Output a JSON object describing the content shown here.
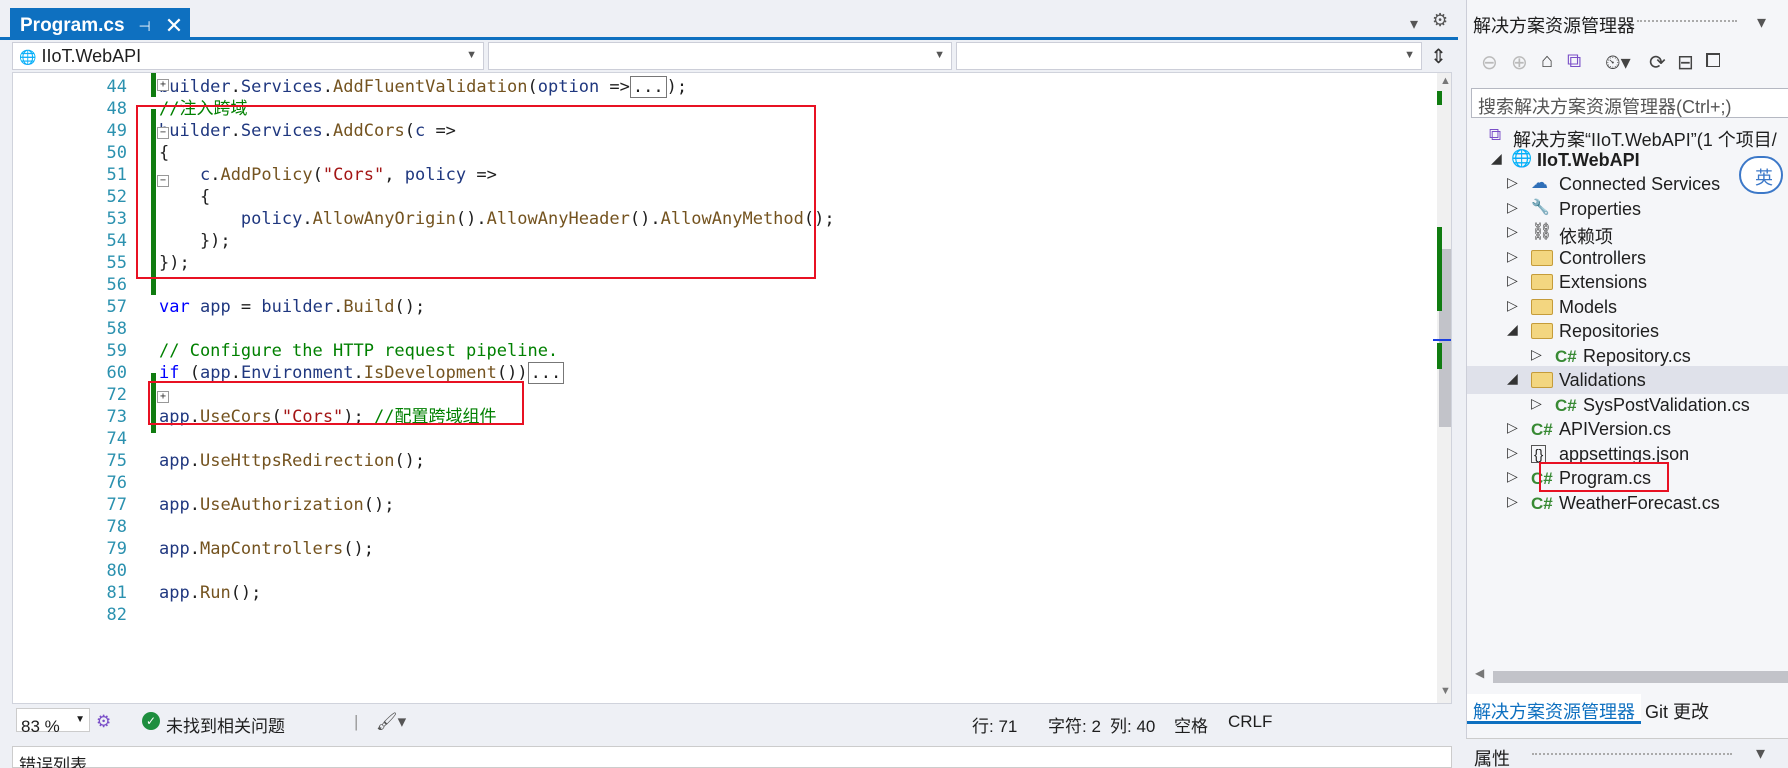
{
  "tab": {
    "title": "Program.cs",
    "pin": "⊣",
    "close": "✕"
  },
  "nav": {
    "project": "IIoT.WebAPI",
    "member": "",
    "symbol": ""
  },
  "code": {
    "lines": [
      {
        "n": "44",
        "parts": [
          [
            "prop",
            "builder"
          ],
          [
            "",
            "."
          ],
          [
            "prop",
            "Services"
          ],
          [
            "",
            "."
          ],
          [
            "mth",
            "AddFluentValidation"
          ],
          [
            "",
            "("
          ],
          [
            "prop",
            "option"
          ],
          [
            "",
            " =>"
          ]
        ],
        "suffix": "...",
        "tail": ");"
      },
      {
        "n": "48",
        "parts": [
          [
            "cm",
            "//注入跨域"
          ]
        ]
      },
      {
        "n": "49",
        "parts": [
          [
            "prop",
            "builder"
          ],
          [
            "",
            "."
          ],
          [
            "prop",
            "Services"
          ],
          [
            "",
            "."
          ],
          [
            "mth",
            "AddCors"
          ],
          [
            "",
            "("
          ],
          [
            "prop",
            "c"
          ],
          [
            "",
            " =>"
          ]
        ]
      },
      {
        "n": "50",
        "parts": [
          [
            "",
            "{"
          ]
        ]
      },
      {
        "n": "51",
        "parts": [
          [
            "",
            "    "
          ],
          [
            "prop",
            "c"
          ],
          [
            "",
            "."
          ],
          [
            "mth",
            "AddPolicy"
          ],
          [
            "",
            "("
          ],
          [
            "str",
            "\"Cors\""
          ],
          [
            "",
            ", "
          ],
          [
            "prop",
            "policy"
          ],
          [
            "",
            " =>"
          ]
        ]
      },
      {
        "n": "52",
        "parts": [
          [
            "",
            "    {"
          ]
        ]
      },
      {
        "n": "53",
        "parts": [
          [
            "",
            "        "
          ],
          [
            "prop",
            "policy"
          ],
          [
            "",
            "."
          ],
          [
            "mth",
            "AllowAnyOrigin"
          ],
          [
            "",
            "()."
          ],
          [
            "mth",
            "AllowAnyHeader"
          ],
          [
            "",
            "()."
          ],
          [
            "mth",
            "AllowAnyMethod"
          ],
          [
            "",
            "();"
          ]
        ]
      },
      {
        "n": "54",
        "parts": [
          [
            "",
            "    });"
          ]
        ]
      },
      {
        "n": "55",
        "parts": [
          [
            "",
            "});"
          ]
        ]
      },
      {
        "n": "56",
        "parts": []
      },
      {
        "n": "57",
        "parts": [
          [
            "kw",
            "var"
          ],
          [
            "",
            " "
          ],
          [
            "prop",
            "app"
          ],
          [
            "",
            " = "
          ],
          [
            "prop",
            "builder"
          ],
          [
            "",
            "."
          ],
          [
            "mth",
            "Build"
          ],
          [
            "",
            "();"
          ]
        ]
      },
      {
        "n": "58",
        "parts": []
      },
      {
        "n": "59",
        "parts": [
          [
            "cm",
            "// Configure the HTTP request pipeline."
          ]
        ]
      },
      {
        "n": "60",
        "parts": [
          [
            "kw",
            "if"
          ],
          [
            "",
            " ("
          ],
          [
            "prop",
            "app"
          ],
          [
            "",
            "."
          ],
          [
            "prop",
            "Environment"
          ],
          [
            "",
            "."
          ],
          [
            "mth",
            "IsDevelopment"
          ],
          [
            "",
            "())"
          ]
        ],
        "suffix": "..."
      },
      {
        "n": "72",
        "parts": []
      },
      {
        "n": "73",
        "parts": [
          [
            "prop",
            "app"
          ],
          [
            "",
            "."
          ],
          [
            "mth",
            "UseCors"
          ],
          [
            "",
            "("
          ],
          [
            "str",
            "\"Cors\""
          ],
          [
            "",
            "); "
          ],
          [
            "cm",
            "//配置跨域组件"
          ]
        ]
      },
      {
        "n": "74",
        "parts": []
      },
      {
        "n": "75",
        "parts": [
          [
            "prop",
            "app"
          ],
          [
            "",
            "."
          ],
          [
            "mth",
            "UseHttpsRedirection"
          ],
          [
            "",
            "();"
          ]
        ]
      },
      {
        "n": "76",
        "parts": []
      },
      {
        "n": "77",
        "parts": [
          [
            "prop",
            "app"
          ],
          [
            "",
            "."
          ],
          [
            "mth",
            "UseAuthorization"
          ],
          [
            "",
            "();"
          ]
        ]
      },
      {
        "n": "78",
        "parts": []
      },
      {
        "n": "79",
        "parts": [
          [
            "prop",
            "app"
          ],
          [
            "",
            "."
          ],
          [
            "mth",
            "MapControllers"
          ],
          [
            "",
            "();"
          ]
        ]
      },
      {
        "n": "80",
        "parts": []
      },
      {
        "n": "81",
        "parts": [
          [
            "prop",
            "app"
          ],
          [
            "",
            "."
          ],
          [
            "mth",
            "Run"
          ],
          [
            "",
            "();"
          ]
        ]
      },
      {
        "n": "82",
        "parts": []
      }
    ]
  },
  "status": {
    "zoom": "83 %",
    "issues": "未找到相关问题",
    "line": "行: 71",
    "char": "字符: 2",
    "col": "列: 40",
    "spacing": "空格",
    "eol": "CRLF"
  },
  "bottom_panel": {
    "title": "错误列表"
  },
  "solution": {
    "title": "解决方案资源管理器",
    "search_placeholder": "搜索解决方案资源管理器(Ctrl+;)",
    "solution_label": "解决方案“IIoT.WebAPI”(1 个项目/",
    "project": "IIoT.WebAPI",
    "items": [
      {
        "label": "Connected Services",
        "icon": "cloud-icon",
        "depth": 2,
        "twisty": "▷"
      },
      {
        "label": "Properties",
        "icon": "wrench-icon",
        "depth": 2,
        "twisty": "▷"
      },
      {
        "label": "依赖项",
        "icon": "dependency-icon",
        "depth": 2,
        "twisty": "▷"
      },
      {
        "label": "Controllers",
        "icon": "folder-icon",
        "depth": 2,
        "twisty": "▷"
      },
      {
        "label": "Extensions",
        "icon": "folder-icon",
        "depth": 2,
        "twisty": "▷"
      },
      {
        "label": "Models",
        "icon": "folder-icon",
        "depth": 2,
        "twisty": "▷"
      },
      {
        "label": "Repositories",
        "icon": "folder-icon",
        "depth": 2,
        "twisty": "◢"
      },
      {
        "label": "Repository.cs",
        "icon": "csharp-icon",
        "depth": 3,
        "twisty": "▷"
      },
      {
        "label": "Validations",
        "icon": "folder-icon",
        "depth": 2,
        "twisty": "◢",
        "selected": true
      },
      {
        "label": "SysPostValidation.cs",
        "icon": "csharp-icon",
        "depth": 3,
        "twisty": "▷"
      },
      {
        "label": "APIVersion.cs",
        "icon": "csharp-icon",
        "depth": 2,
        "twisty": "▷"
      },
      {
        "label": "appsettings.json",
        "icon": "json-icon",
        "depth": 2,
        "twisty": "▷"
      },
      {
        "label": "Program.cs",
        "icon": "csharp-icon",
        "depth": 2,
        "twisty": "▷",
        "highlighted": true
      },
      {
        "label": "WeatherForecast.cs",
        "icon": "csharp-icon",
        "depth": 2,
        "twisty": "▷"
      }
    ],
    "tab_explorer": "解决方案资源管理器",
    "tab_git": "Git 更改",
    "csharp_glyph": "C#"
  },
  "properties": {
    "title": "属性"
  },
  "colors": {
    "accent": "#0e70c0",
    "highlight": "#e81123",
    "change_bar": "#107c10"
  }
}
